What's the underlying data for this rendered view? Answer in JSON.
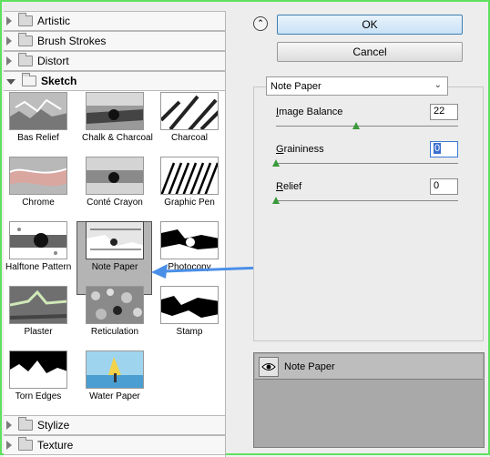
{
  "categories_top": [
    {
      "label": "Artistic"
    },
    {
      "label": "Brush Strokes"
    },
    {
      "label": "Distort"
    },
    {
      "label": "Sketch"
    }
  ],
  "categories_bottom": [
    {
      "label": "Stylize"
    },
    {
      "label": "Texture"
    }
  ],
  "thumbnails": [
    {
      "label": "Bas Relief"
    },
    {
      "label": "Chalk & Charcoal"
    },
    {
      "label": "Charcoal"
    },
    {
      "label": "Chrome"
    },
    {
      "label": "Conté Crayon"
    },
    {
      "label": "Graphic Pen"
    },
    {
      "label": "Halftone Pattern"
    },
    {
      "label": "Note Paper"
    },
    {
      "label": "Photocopy"
    },
    {
      "label": "Plaster"
    },
    {
      "label": "Reticulation"
    },
    {
      "label": "Stamp"
    },
    {
      "label": "Torn Edges"
    },
    {
      "label": "Water Paper"
    }
  ],
  "buttons": {
    "ok": "OK",
    "cancel": "Cancel",
    "collapse": "⌃"
  },
  "filter_select": {
    "value": "Note Paper"
  },
  "params": [
    {
      "label_first": "I",
      "label_rest": "mage Balance",
      "value": "22",
      "level": 0.44
    },
    {
      "label_first": "G",
      "label_rest": "raininess",
      "value": "0",
      "level": 0
    },
    {
      "label_first": "R",
      "label_rest": "elief",
      "value": "0",
      "level": 0
    }
  ],
  "layers": {
    "active_label": "Note Paper"
  }
}
